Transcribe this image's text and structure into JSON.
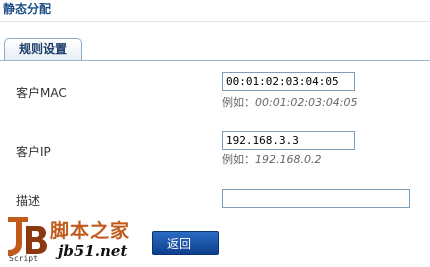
{
  "header": {
    "title": "静态分配"
  },
  "tabs": [
    {
      "label": "规则设置"
    }
  ],
  "form": {
    "mac": {
      "label": "客户MAC",
      "value": "00:01:02:03:04:05",
      "example_prefix": "例如：",
      "example_value": "00:01:02:03:04:05"
    },
    "ip": {
      "label": "客户IP",
      "value": "192.168.3.3",
      "example_prefix": "例如：",
      "example_value": "192.168.0.2"
    },
    "desc": {
      "label": "描述",
      "value": ""
    }
  },
  "watermark": {
    "brand_cn": "脚本之家",
    "url": "jb51.net",
    "script_label": "Script",
    "logo_text": "JB"
  },
  "buttons": {
    "back_label": "返回"
  },
  "colors": {
    "title": "#1f4f86",
    "button": "#1a55a8",
    "watermark_orange": "#c15b1b"
  }
}
